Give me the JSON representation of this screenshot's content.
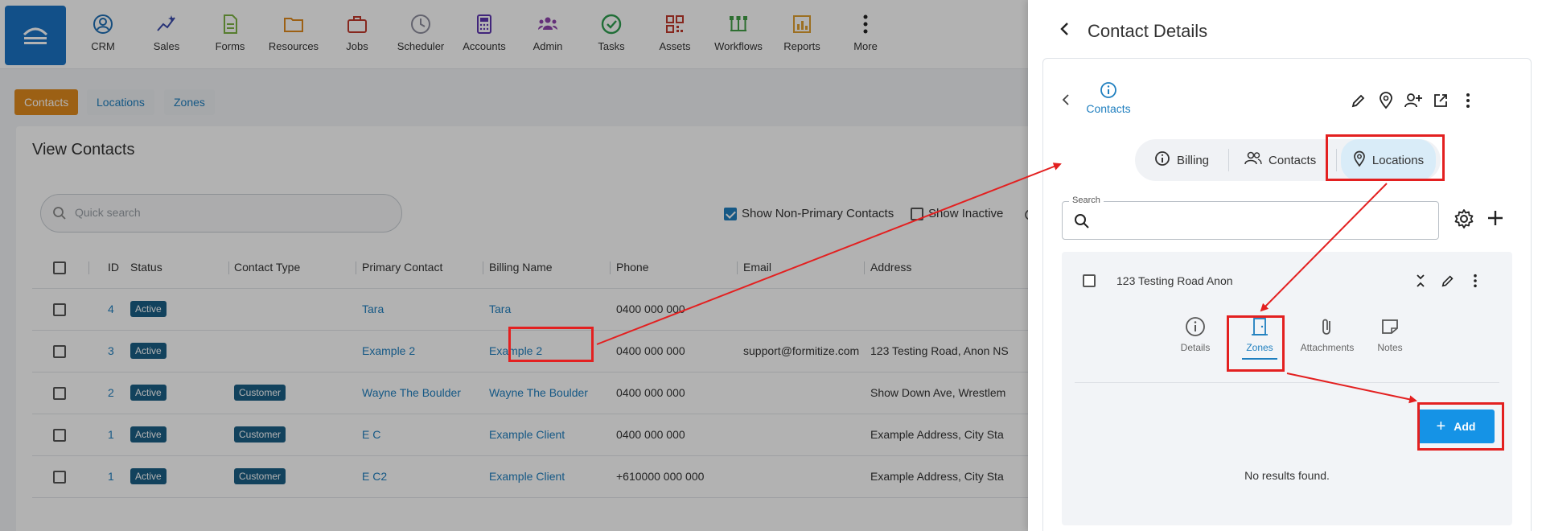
{
  "nav": {
    "items": [
      {
        "label": "CRM",
        "icon": "person-circle-icon",
        "color": "#1f6fb5"
      },
      {
        "label": "Sales",
        "icon": "sparkle-chart-icon",
        "color": "#3949ab"
      },
      {
        "label": "Forms",
        "icon": "document-icon",
        "color": "#7cb342"
      },
      {
        "label": "Resources",
        "icon": "folder-icon",
        "color": "#e08a1e"
      },
      {
        "label": "Jobs",
        "icon": "briefcase-icon",
        "color": "#c0392b"
      },
      {
        "label": "Scheduler",
        "icon": "clock-icon",
        "color": "#8e8e9e"
      },
      {
        "label": "Accounts",
        "icon": "calculator-icon",
        "color": "#5e35b1"
      },
      {
        "label": "Admin",
        "icon": "people-group-icon",
        "color": "#8e44ad"
      },
      {
        "label": "Tasks",
        "icon": "check-circle-icon",
        "color": "#2e9e4f"
      },
      {
        "label": "Assets",
        "icon": "qr-code-icon",
        "color": "#c0392b"
      },
      {
        "label": "Workflows",
        "icon": "workflow-icon",
        "color": "#43a047"
      },
      {
        "label": "Reports",
        "icon": "bar-chart-icon",
        "color": "#e0a030"
      },
      {
        "label": "More",
        "icon": "more-vertical-icon",
        "color": "#222222"
      }
    ]
  },
  "subtabs": [
    "Contacts",
    "Locations",
    "Zones"
  ],
  "view": {
    "title": "View Contacts",
    "search_placeholder": "Quick search",
    "show_non_primary": "Show Non-Primary Contacts",
    "show_inactive": "Show Inactive"
  },
  "table": {
    "headers": [
      "ID",
      "Status",
      "Contact Type",
      "Primary Contact",
      "Billing Name",
      "Phone",
      "Email",
      "Address"
    ],
    "rows": [
      {
        "id": "4",
        "status": "Active",
        "type": "",
        "primary": "Tara",
        "billing": "Tara",
        "phone": "0400 000 000",
        "email": "",
        "address": ""
      },
      {
        "id": "3",
        "status": "Active",
        "type": "",
        "primary": "Example 2",
        "billing": "Example 2",
        "phone": "0400 000 000",
        "email": "support@formitize.com",
        "address": "123 Testing Road, Anon NS"
      },
      {
        "id": "2",
        "status": "Active",
        "type": "Customer",
        "primary": "Wayne The Boulder",
        "billing": "Wayne The Boulder",
        "phone": "0400 000 000",
        "email": "",
        "address": "Show Down Ave, Wrestlem"
      },
      {
        "id": "1",
        "status": "Active",
        "type": "Customer",
        "primary": "E C",
        "billing": "Example Client",
        "phone": "0400 000 000",
        "email": "",
        "address": "Example Address, City Sta"
      },
      {
        "id": "1",
        "status": "Active",
        "type": "Customer",
        "primary": "E C2",
        "billing": "Example Client",
        "phone": "+610000 000 000",
        "email": "",
        "address": "Example Address, City Sta"
      }
    ]
  },
  "drawer": {
    "title": "Contact Details",
    "contacts_tab": "Contacts",
    "segments": [
      "Billing",
      "Contacts",
      "Locations"
    ],
    "search_label": "Search",
    "location_name": "123 Testing Road Anon",
    "subtabs": [
      "Details",
      "Zones",
      "Attachments",
      "Notes"
    ],
    "add_label": "Add",
    "empty_text": "No results found."
  },
  "colors": {
    "accent": "#1f7fbf",
    "active_tab": "#e08a1e",
    "annotation": "#e32020",
    "add_button": "#1593e6"
  }
}
